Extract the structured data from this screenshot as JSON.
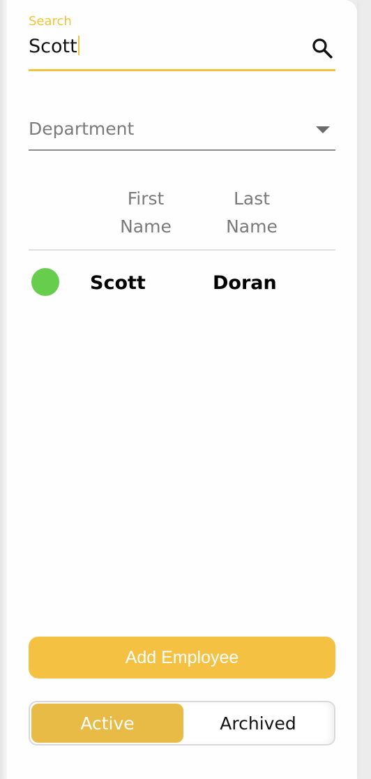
{
  "search": {
    "label": "Search",
    "value": "Scott"
  },
  "filter": {
    "department_placeholder": "Department"
  },
  "table": {
    "headers": {
      "first_line1": "First",
      "first_line2": "Name",
      "last_line1": "Last",
      "last_line2": "Name"
    },
    "rows": [
      {
        "status_color": "#67cd4c",
        "first_name": "Scott",
        "last_name": "Doran"
      }
    ]
  },
  "actions": {
    "add_employee_label": "Add Employee"
  },
  "toggle": {
    "active_label": "Active",
    "archived_label": "Archived",
    "selected": "Active"
  },
  "colors": {
    "accent": "#f2c33c",
    "button": "#f4c142",
    "active_status": "#67cd4c"
  },
  "icons": {
    "search": "search-icon",
    "dropdown": "chevron-down-icon",
    "status": "status-dot"
  }
}
